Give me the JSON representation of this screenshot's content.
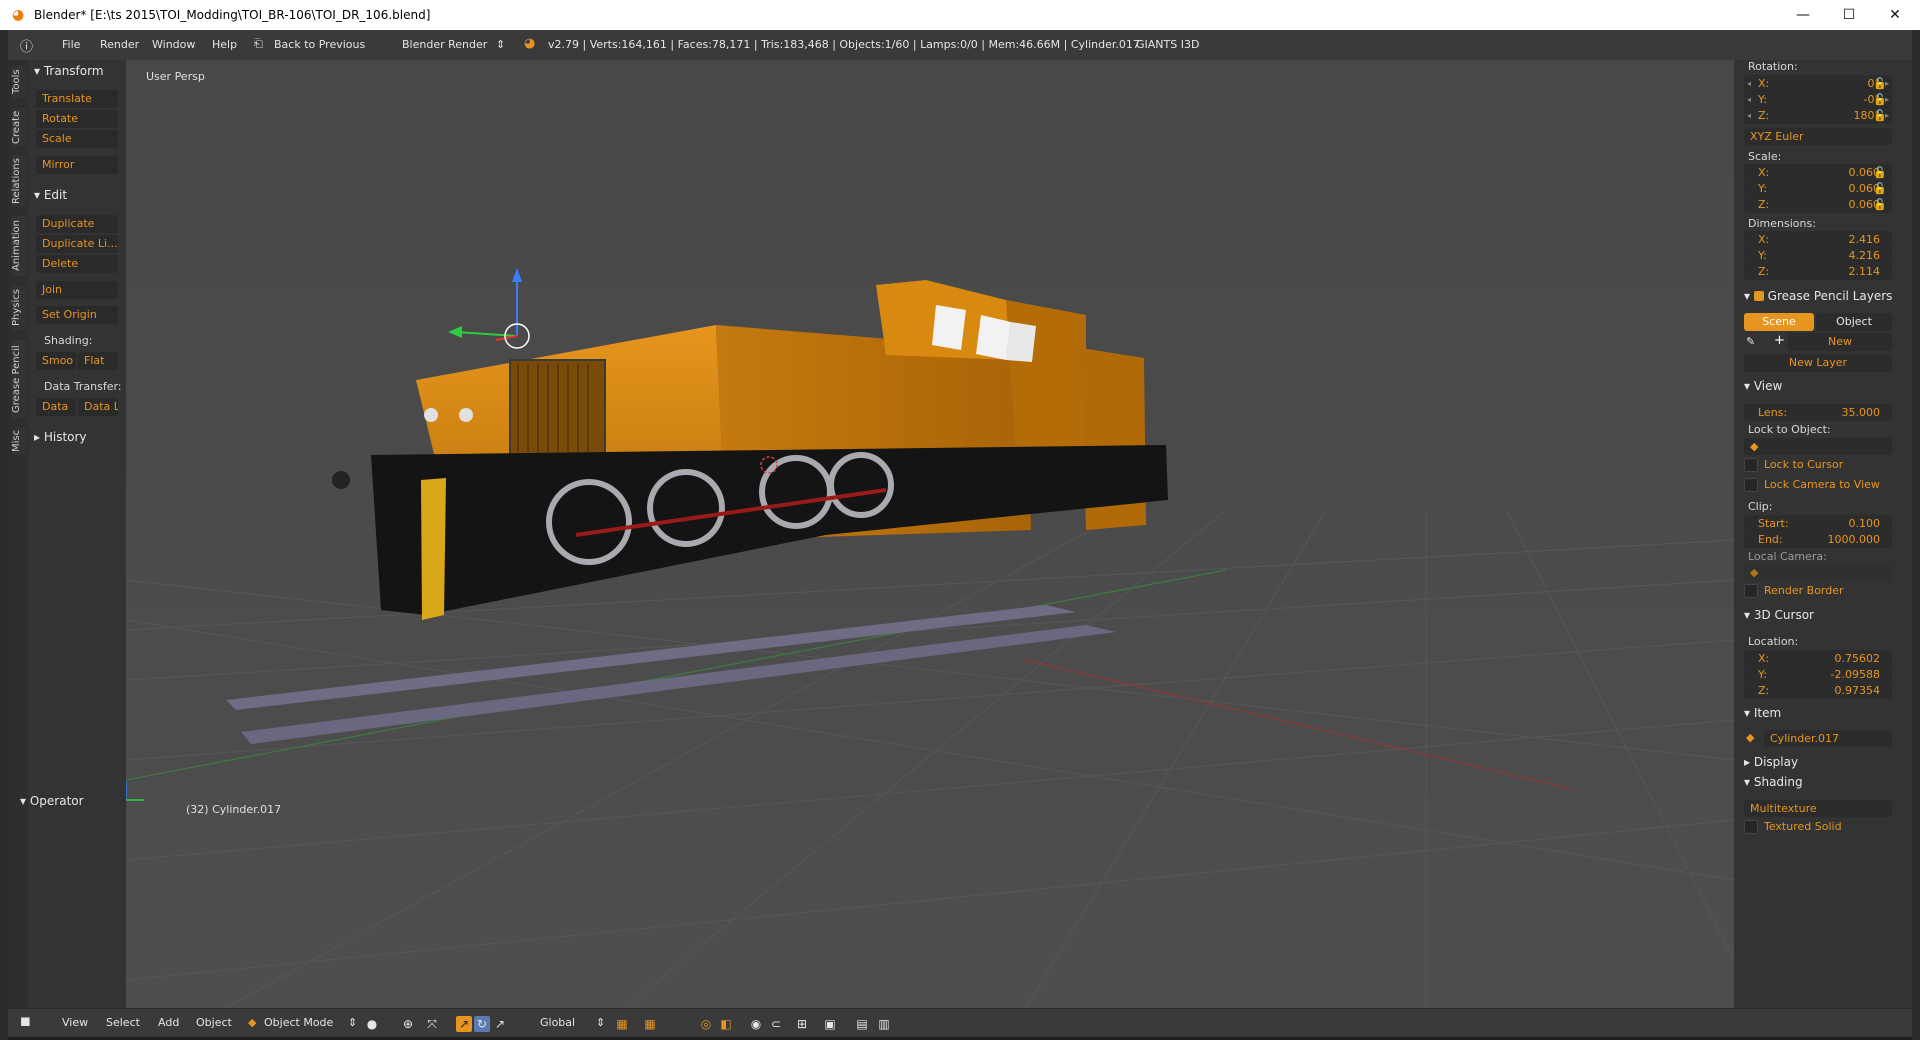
{
  "window": {
    "title": "Blender* [E:\\ts 2015\\TOI_Modding\\TOI_BR-106\\TOI_DR_106.blend]",
    "minimize": "—",
    "maximize": "☐",
    "close": "✕"
  },
  "info_bar": {
    "menu": [
      "File",
      "Render",
      "Window",
      "Help"
    ],
    "back_label": "Back to Previous",
    "engine": "Blender Render",
    "stats": "v2.79 | Verts:164,161 | Faces:78,171 | Tris:183,468 | Objects:1/60 | Lamps:0/0 | Mem:46.66M | Cylinder.017",
    "addon": "GIANTS I3D"
  },
  "side_tabs": [
    "Tools",
    "Create",
    "Relations",
    "Animation",
    "Physics",
    "Grease Pencil",
    "Misc"
  ],
  "tools": {
    "transform_header": "Transform",
    "translate": "Translate",
    "rotate": "Rotate",
    "scale": "Scale",
    "mirror": "Mirror",
    "edit_header": "Edit",
    "duplicate": "Duplicate",
    "duplicate_linked": "Duplicate Li...",
    "delete": "Delete",
    "join": "Join",
    "set_origin": "Set Origin",
    "shading_label": "Shading:",
    "smooth": "Smoo",
    "flat": "Flat",
    "data_transfer_label": "Data Transfer:",
    "data": "Data",
    "data_layout": "Data L",
    "history_header": "History",
    "operator_header": "Operator"
  },
  "viewport": {
    "view_label": "User Persp",
    "object_label": "(32) Cylinder.017"
  },
  "properties": {
    "rotation_label": "Rotation:",
    "rotation": [
      {
        "k": "X:",
        "v": "0°"
      },
      {
        "k": "Y:",
        "v": "-0°"
      },
      {
        "k": "Z:",
        "v": "180°"
      }
    ],
    "rotation_mode": "XYZ Euler",
    "scale_label": "Scale:",
    "scale": [
      {
        "k": "X:",
        "v": "0.060"
      },
      {
        "k": "Y:",
        "v": "0.060"
      },
      {
        "k": "Z:",
        "v": "0.060"
      }
    ],
    "dimensions_label": "Dimensions:",
    "dimensions": [
      {
        "k": "X:",
        "v": "2.416"
      },
      {
        "k": "Y:",
        "v": "4.216"
      },
      {
        "k": "Z:",
        "v": "2.114"
      }
    ],
    "grease_header": "Grease Pencil Layers",
    "scene_btn": "Scene",
    "object_btn": "Object",
    "new_btn": "New",
    "new_layer_btn": "New Layer",
    "view_header": "View",
    "lens_k": "Lens:",
    "lens_v": "35.000",
    "lock_object_label": "Lock to Object:",
    "lock_cursor": "Lock to Cursor",
    "lock_camera": "Lock Camera to View",
    "clip_label": "Clip:",
    "clip_start_k": "Start:",
    "clip_start_v": "0.100",
    "clip_end_k": "End:",
    "clip_end_v": "1000.000",
    "local_camera_label": "Local Camera:",
    "render_border": "Render Border",
    "cursor_header": "3D Cursor",
    "location_label": "Location:",
    "location": [
      {
        "k": "X:",
        "v": "0.75602"
      },
      {
        "k": "Y:",
        "v": "-2.09588"
      },
      {
        "k": "Z:",
        "v": "0.97354"
      }
    ],
    "item_header": "Item",
    "item_name": "Cylinder.017",
    "display_header": "Display",
    "shading_header": "Shading",
    "shading_mode": "Multitexture",
    "textured_solid": "Textured Solid"
  },
  "bottom_bar": {
    "menu": [
      "View",
      "Select",
      "Add",
      "Object"
    ],
    "mode": "Object Mode",
    "orientation": "Global"
  },
  "colors": {
    "accent": "#e69520",
    "loco_body": "#d98a14",
    "chassis": "#141414"
  }
}
